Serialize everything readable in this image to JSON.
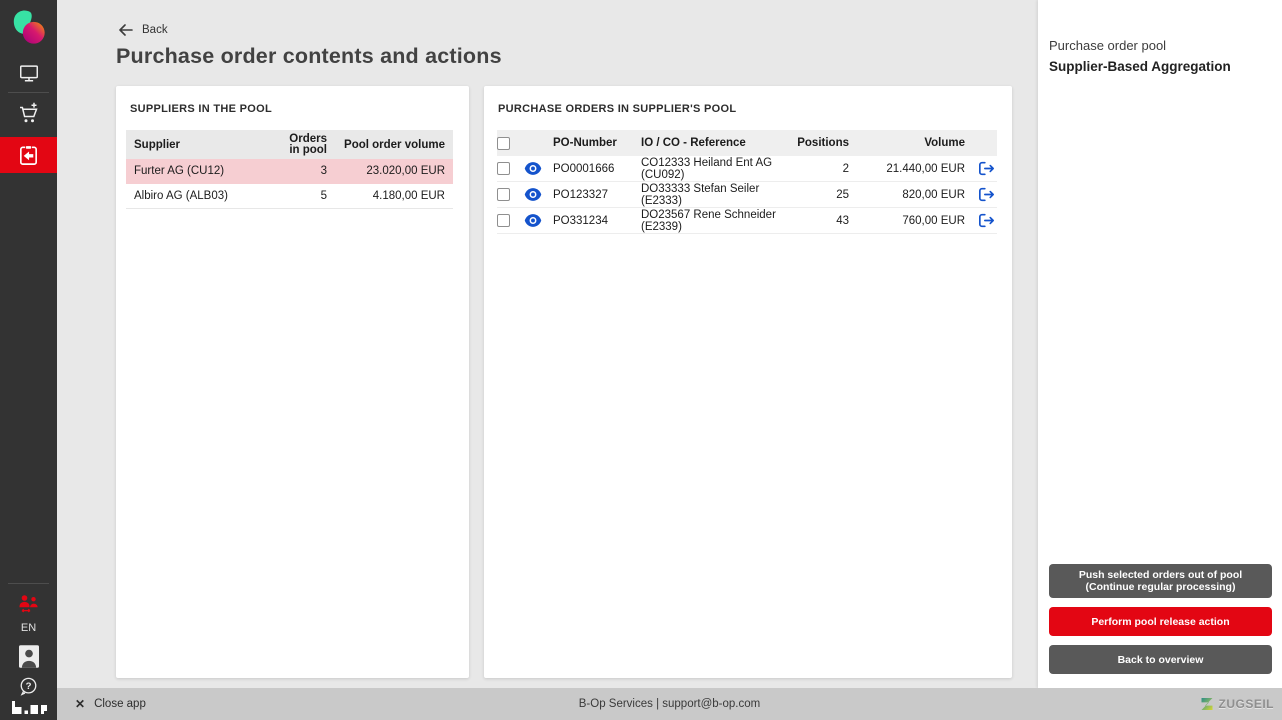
{
  "sidebar": {
    "language": "EN",
    "icons": [
      "app-logo",
      "monitor-icon",
      "cart-add-icon",
      "clipboard-return-icon",
      "users-transfer-icon",
      "avatar-icon",
      "help-icon",
      "bop-logo"
    ]
  },
  "header": {
    "back_label": "Back",
    "title": "Purchase order contents and actions"
  },
  "suppliers_panel": {
    "title": "SUPPLIERS IN THE POOL",
    "columns": {
      "supplier": "Supplier",
      "orders_line1": "Orders",
      "orders_line2": "in pool",
      "volume": "Pool order volume"
    },
    "rows": [
      {
        "supplier": "Furter AG (CU12)",
        "orders": "3",
        "volume": "23.020,00 EUR"
      },
      {
        "supplier": "Albiro AG (ALB03)",
        "orders": "5",
        "volume": "4.180,00 EUR"
      }
    ]
  },
  "orders_panel": {
    "title": "PURCHASE ORDERS IN SUPPLIER'S POOL",
    "columns": {
      "po_number": "PO-Number",
      "reference": "IO / CO - Reference",
      "positions": "Positions",
      "volume": "Volume"
    },
    "rows": [
      {
        "po_number": "PO0001666",
        "reference": "CO12333 Heiland Ent AG (CU092)",
        "positions": "2",
        "volume": "21.440,00 EUR"
      },
      {
        "po_number": "PO123327",
        "reference": "DO33333 Stefan Seiler (E2333)",
        "positions": "25",
        "volume": "820,00 EUR"
      },
      {
        "po_number": "PO331234",
        "reference": "DO23567 Rene Schneider (E2339)",
        "positions": "43",
        "volume": "760,00 EUR"
      }
    ]
  },
  "right_panel": {
    "subtitle": "Purchase order pool",
    "title": "Supplier-Based Aggregation",
    "buttons": {
      "push_line1": "Push selected orders out of pool",
      "push_line2": "(Continue regular processing)",
      "release": "Perform pool release action",
      "back": "Back to overview"
    }
  },
  "footer": {
    "close_label": "Close app",
    "center_text": "B-Op Services | support@b-op.com",
    "brand": "ZUGSEIL"
  },
  "colors": {
    "accent_red": "#e30613",
    "selected_row_pink": "#f6ced2",
    "link_blue": "#1453cc",
    "sidebar_bg": "#333333"
  }
}
